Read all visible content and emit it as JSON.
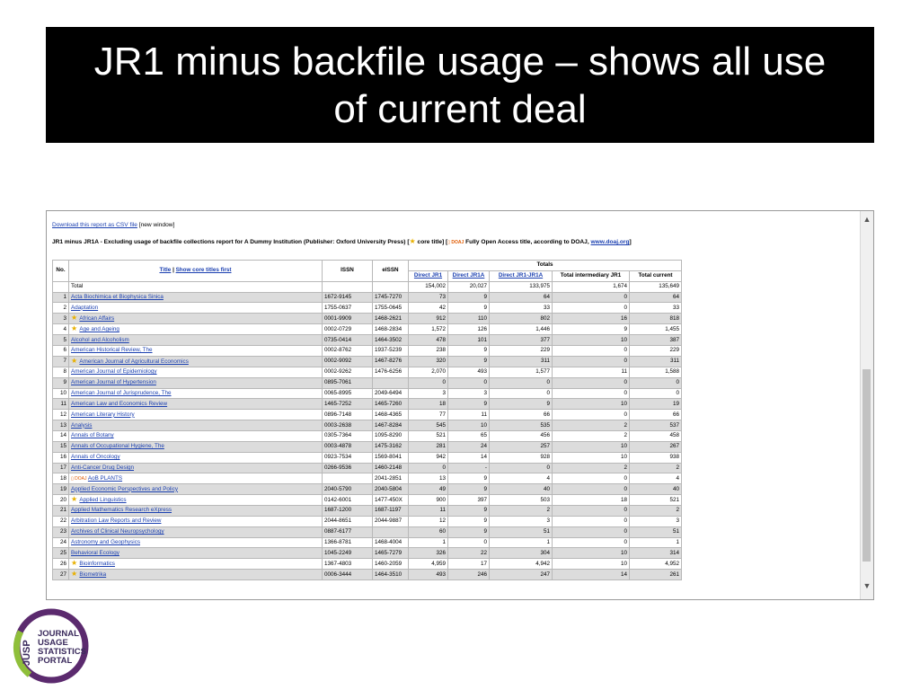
{
  "slide": {
    "title": "JR1 minus backfile usage – shows all use of current deal"
  },
  "report": {
    "csv_link": "Download this report as CSV file",
    "csv_new_window": "[new window]",
    "title_prefix": "JR1 minus JR1A - Excluding usage of backfile collections report for A Dummy Institution (Publisher: Oxford University Press) [",
    "core_title": "core title] [",
    "doaj_note": "Fully Open Access title, according to DOAJ,",
    "doaj_link": "www.doaj.org",
    "closing": "]"
  },
  "table": {
    "headers": {
      "no": "No.",
      "title": "Title",
      "sep": "|",
      "show_core": "Show core titles first",
      "issn": "ISSN",
      "eissn": "eISSN",
      "totals": "Totals",
      "direct_jr1": "Direct JR1",
      "direct_jr1a": "Direct JR1A",
      "direct_diff": "Direct JR1-JR1A",
      "total_intermediary": "Total intermediary JR1",
      "total_current": "Total current"
    },
    "total_row": {
      "label": "Total",
      "jr1": "154,002",
      "jr1a": "20,027",
      "diff": "133,975",
      "inter": "1,674",
      "current": "135,649"
    },
    "rows": [
      {
        "no": "1",
        "mark": "",
        "title": "Acta Biochimica et Biophysica Sinica",
        "issn": "1672-9145",
        "eissn": "1745-7270",
        "jr1": "73",
        "jr1a": "9",
        "diff": "64",
        "inter": "0",
        "current": "64"
      },
      {
        "no": "2",
        "mark": "",
        "title": "Adaptation",
        "issn": "1755-0637",
        "eissn": "1755-0645",
        "jr1": "42",
        "jr1a": "9",
        "diff": "33",
        "inter": "0",
        "current": "33"
      },
      {
        "no": "3",
        "mark": "star",
        "title": "African Affairs",
        "issn": "0001-9909",
        "eissn": "1468-2621",
        "jr1": "912",
        "jr1a": "110",
        "diff": "802",
        "inter": "16",
        "current": "818"
      },
      {
        "no": "4",
        "mark": "star",
        "title": "Age and Ageing",
        "issn": "0002-0729",
        "eissn": "1468-2834",
        "jr1": "1,572",
        "jr1a": "126",
        "diff": "1,446",
        "inter": "9",
        "current": "1,455"
      },
      {
        "no": "5",
        "mark": "",
        "title": "Alcohol and Alcoholism",
        "issn": "0735-0414",
        "eissn": "1464-3502",
        "jr1": "478",
        "jr1a": "101",
        "diff": "377",
        "inter": "10",
        "current": "387"
      },
      {
        "no": "6",
        "mark": "",
        "title": "American Historical Review, The",
        "issn": "0002-8762",
        "eissn": "1937-5239",
        "jr1": "238",
        "jr1a": "9",
        "diff": "229",
        "inter": "0",
        "current": "229"
      },
      {
        "no": "7",
        "mark": "star",
        "title": "American Journal of Agricultural Economics",
        "issn": "0002-9092",
        "eissn": "1467-8276",
        "jr1": "320",
        "jr1a": "9",
        "diff": "311",
        "inter": "0",
        "current": "311"
      },
      {
        "no": "8",
        "mark": "",
        "title": "American Journal of Epidemiology",
        "issn": "0002-9262",
        "eissn": "1476-6256",
        "jr1": "2,070",
        "jr1a": "493",
        "diff": "1,577",
        "inter": "11",
        "current": "1,588"
      },
      {
        "no": "9",
        "mark": "",
        "title": "American Journal of Hypertension",
        "issn": "0895-7061",
        "eissn": "",
        "jr1": "0",
        "jr1a": "0",
        "diff": "0",
        "inter": "0",
        "current": "0"
      },
      {
        "no": "10",
        "mark": "",
        "title": "American Journal of Jurisprudence, The",
        "issn": "0065-8995",
        "eissn": "2049-6494",
        "jr1": "3",
        "jr1a": "3",
        "diff": "0",
        "inter": "0",
        "current": "0"
      },
      {
        "no": "11",
        "mark": "",
        "title": "American Law and Economics Review",
        "issn": "1465-7252",
        "eissn": "1465-7260",
        "jr1": "18",
        "jr1a": "9",
        "diff": "9",
        "inter": "10",
        "current": "19"
      },
      {
        "no": "12",
        "mark": "",
        "title": "American Literary History",
        "issn": "0896-7148",
        "eissn": "1468-4365",
        "jr1": "77",
        "jr1a": "11",
        "diff": "66",
        "inter": "0",
        "current": "66"
      },
      {
        "no": "13",
        "mark": "",
        "title": "Analysis",
        "issn": "0003-2638",
        "eissn": "1467-8284",
        "jr1": "545",
        "jr1a": "10",
        "diff": "535",
        "inter": "2",
        "current": "537"
      },
      {
        "no": "14",
        "mark": "",
        "title": "Annals of Botany",
        "issn": "0305-7364",
        "eissn": "1095-8290",
        "jr1": "521",
        "jr1a": "65",
        "diff": "456",
        "inter": "2",
        "current": "458"
      },
      {
        "no": "15",
        "mark": "",
        "title": "Annals of Occupational Hygiene, The",
        "issn": "0003-4878",
        "eissn": "1475-3162",
        "jr1": "281",
        "jr1a": "24",
        "diff": "257",
        "inter": "10",
        "current": "267"
      },
      {
        "no": "16",
        "mark": "",
        "title": "Annals of Oncology",
        "issn": "0923-7534",
        "eissn": "1569-8041",
        "jr1": "942",
        "jr1a": "14",
        "diff": "928",
        "inter": "10",
        "current": "938"
      },
      {
        "no": "17",
        "mark": "",
        "title": "Anti-Cancer Drug Design",
        "issn": "0266-9536",
        "eissn": "1460-2148",
        "jr1": "0",
        "jr1a": "-",
        "diff": "0",
        "inter": "2",
        "current": "2"
      },
      {
        "no": "18",
        "mark": "doaj",
        "title": "AoB PLANTS",
        "issn": "",
        "eissn": "2041-2851",
        "jr1": "13",
        "jr1a": "9",
        "diff": "4",
        "inter": "0",
        "current": "4"
      },
      {
        "no": "19",
        "mark": "",
        "title": "Applied Economic Perspectives and Policy",
        "issn": "2040-5790",
        "eissn": "2040-5804",
        "jr1": "49",
        "jr1a": "9",
        "diff": "40",
        "inter": "0",
        "current": "40"
      },
      {
        "no": "20",
        "mark": "star",
        "title": "Applied Linguistics",
        "issn": "0142-6001",
        "eissn": "1477-450X",
        "jr1": "900",
        "jr1a": "397",
        "diff": "503",
        "inter": "18",
        "current": "521"
      },
      {
        "no": "21",
        "mark": "",
        "title": "Applied Mathematics Research eXpress",
        "issn": "1687-1200",
        "eissn": "1687-1197",
        "jr1": "11",
        "jr1a": "9",
        "diff": "2",
        "inter": "0",
        "current": "2"
      },
      {
        "no": "22",
        "mark": "",
        "title": "Arbitration Law Reports and Review",
        "issn": "2044-8651",
        "eissn": "2044-9887",
        "jr1": "12",
        "jr1a": "9",
        "diff": "3",
        "inter": "0",
        "current": "3"
      },
      {
        "no": "23",
        "mark": "",
        "title": "Archives of Clinical Neuropsychology",
        "issn": "0887-6177",
        "eissn": "",
        "jr1": "60",
        "jr1a": "9",
        "diff": "51",
        "inter": "0",
        "current": "51"
      },
      {
        "no": "24",
        "mark": "",
        "title": "Astronomy and Geophysics",
        "issn": "1366-8781",
        "eissn": "1468-4004",
        "jr1": "1",
        "jr1a": "0",
        "diff": "1",
        "inter": "0",
        "current": "1"
      },
      {
        "no": "25",
        "mark": "",
        "title": "Behavioral Ecology",
        "issn": "1045-2249",
        "eissn": "1465-7279",
        "jr1": "326",
        "jr1a": "22",
        "diff": "304",
        "inter": "10",
        "current": "314"
      },
      {
        "no": "26",
        "mark": "star",
        "title": "Bioinformatics",
        "issn": "1367-4803",
        "eissn": "1460-2059",
        "jr1": "4,959",
        "jr1a": "17",
        "diff": "4,942",
        "inter": "10",
        "current": "4,952"
      },
      {
        "no": "27",
        "mark": "star",
        "title": "Biometrika",
        "issn": "0006-3444",
        "eissn": "1464-3510",
        "jr1": "493",
        "jr1a": "246",
        "diff": "247",
        "inter": "14",
        "current": "261"
      }
    ]
  },
  "logo": {
    "line1": "JOURNAL",
    "line2": "USAGE",
    "line3": "STATISTICS",
    "line4": "PORTAL",
    "mark": "JUSP"
  }
}
